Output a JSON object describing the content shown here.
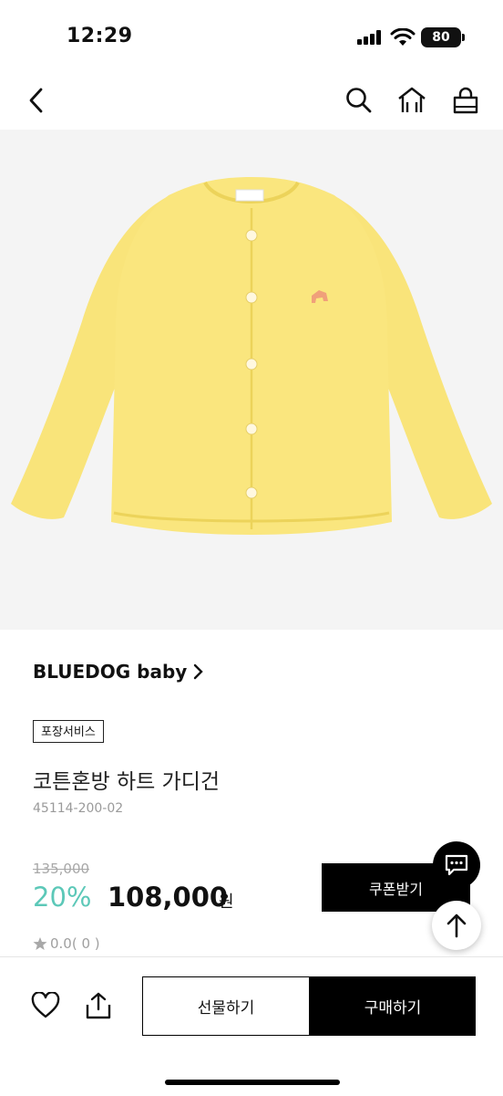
{
  "status_bar": {
    "time": "12:29",
    "battery": "80"
  },
  "product": {
    "brand": "BLUEDOG baby",
    "service_tag": "포장서비스",
    "name": "코튼혼방 하트 가디건",
    "code": "45114-200-02",
    "original_price": "135,000",
    "discount": "20%",
    "sale_price": "108,000",
    "currency": "원",
    "rating": "0.0( 0 )",
    "image_colors": {
      "cardigan": "#f9e47a",
      "background": "#f4f4f4"
    }
  },
  "actions": {
    "coupon": "쿠폰받기",
    "gift": "선물하기",
    "buy": "구매하기"
  },
  "icons": [
    "back-icon",
    "search-icon",
    "home-icon",
    "cart-icon",
    "chat-icon",
    "arrow-up-icon",
    "heart-icon",
    "share-icon",
    "star-icon"
  ],
  "colors": {
    "accent": "#5cc8b8",
    "primary": "#000000"
  }
}
